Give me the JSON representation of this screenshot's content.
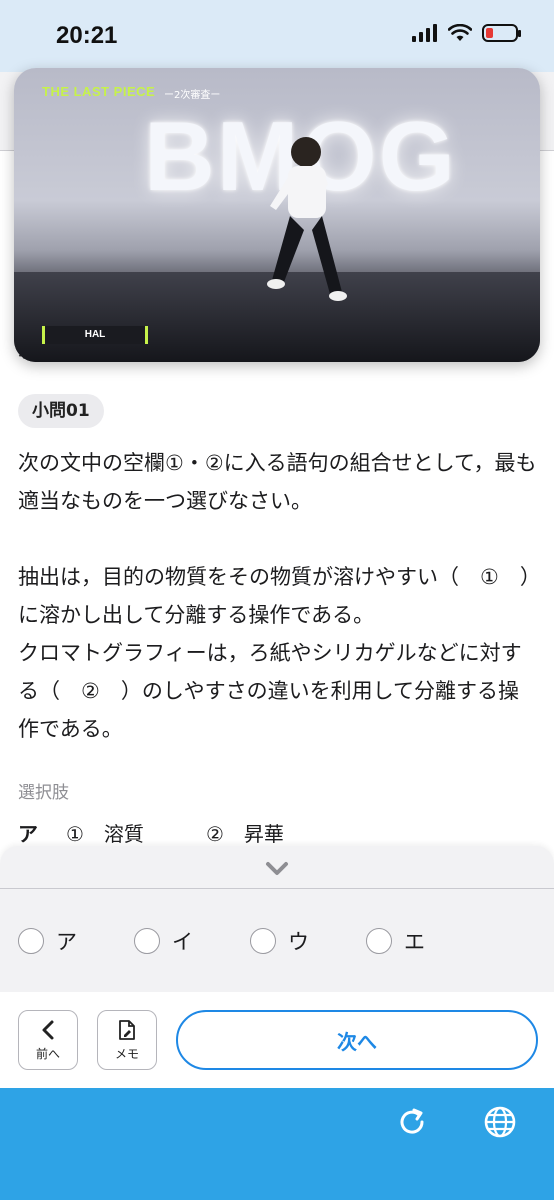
{
  "status_bar": {
    "time": "20:21",
    "icons": [
      "signal-icon",
      "wifi-icon",
      "battery-low-icon"
    ],
    "battery_color": "#e53935"
  },
  "video": {
    "show_logo": "THE LAST PIECE",
    "show_subtitle": "ー2次審査ー",
    "backdrop_text": "BMOG",
    "name_tag": "HAL"
  },
  "question": {
    "partial_char": "次",
    "badge": "小問01",
    "text": "次の文中の空欄①・②に入る語句の組合せとして，最も適当なものを一つ選びなさい。\n\n抽出は，目的の物質をその物質が溶けやすい（　①　）に溶かし出して分離する操作である。\nクロマトグラフィーは，ろ紙やシリカゲルなどに対する（　②　）のしやすさの違いを利用して分離する操作である。"
  },
  "choices": {
    "label": "選択肢",
    "rows": [
      {
        "key": "ア",
        "c1": "①　溶質",
        "c2": "②　昇華"
      }
    ]
  },
  "answer_panel": {
    "collapse_icon": "chevron-down-icon",
    "options": [
      "ア",
      "イ",
      "ウ",
      "エ"
    ]
  },
  "nav": {
    "prev_label": "前へ",
    "memo_label": "メモ",
    "next_label": "次へ"
  },
  "browser_bar": {
    "icons": [
      "reload-icon",
      "globe-icon"
    ],
    "color": "#2ea3e6",
    "accent": "#1e88e5"
  }
}
